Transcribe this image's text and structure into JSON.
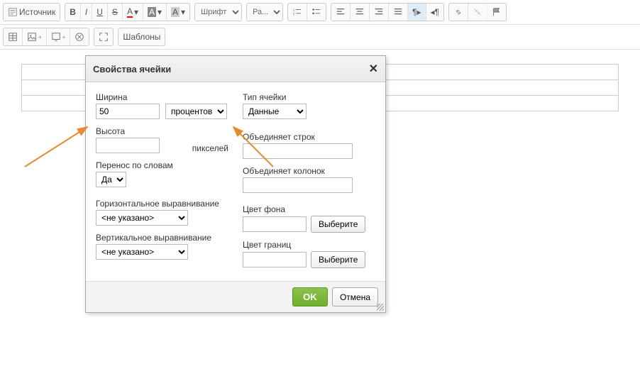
{
  "toolbar": {
    "source": "Источник",
    "font_label": "Шрифт",
    "size_label": "Ра...",
    "templates": "Шаблоны"
  },
  "dialog": {
    "title": "Свойства ячейки",
    "width_label": "Ширина",
    "width_value": "50",
    "width_unit": "процентов",
    "height_label": "Высота",
    "height_value": "",
    "height_unit": "пикселей",
    "wrap_label": "Перенос по словам",
    "wrap_value": "Да",
    "halign_label": "Горизонтальное выравнивание",
    "halign_value": "<не указано>",
    "valign_label": "Вертикальное выравнивание",
    "valign_value": "<не указано>",
    "celltype_label": "Тип ячейки",
    "celltype_value": "Данные",
    "rowspan_label": "Объединяет строк",
    "rowspan_value": "",
    "colspan_label": "Объединяет колонок",
    "colspan_value": "",
    "bgcolor_label": "Цвет фона",
    "bgcolor_value": "",
    "bordercolor_label": "Цвет границ",
    "bordercolor_value": "",
    "choose_btn": "Выберите",
    "ok": "OK",
    "cancel": "Отмена"
  }
}
